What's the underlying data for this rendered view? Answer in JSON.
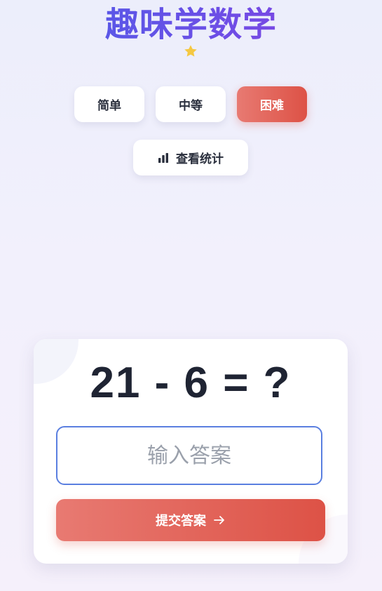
{
  "header": {
    "title": "趣味学数学",
    "star_icon": "star-icon",
    "star_color": "#f5c842"
  },
  "difficulty": {
    "options": [
      "简单",
      "中等",
      "困难"
    ],
    "selected": "困难"
  },
  "stats": {
    "label": "查看统计",
    "icon": "bar-chart-icon"
  },
  "quiz": {
    "problem": "21 - 6 = ?",
    "answer_placeholder": "输入答案",
    "answer_value": "",
    "submit_label": "提交答案",
    "submit_icon": "arrow-right-icon"
  },
  "colors": {
    "accent_red": "#dd5246",
    "title_gradient_start": "#4a5ee8",
    "title_gradient_end": "#8a3fe0",
    "input_border": "#5a7fe0"
  }
}
